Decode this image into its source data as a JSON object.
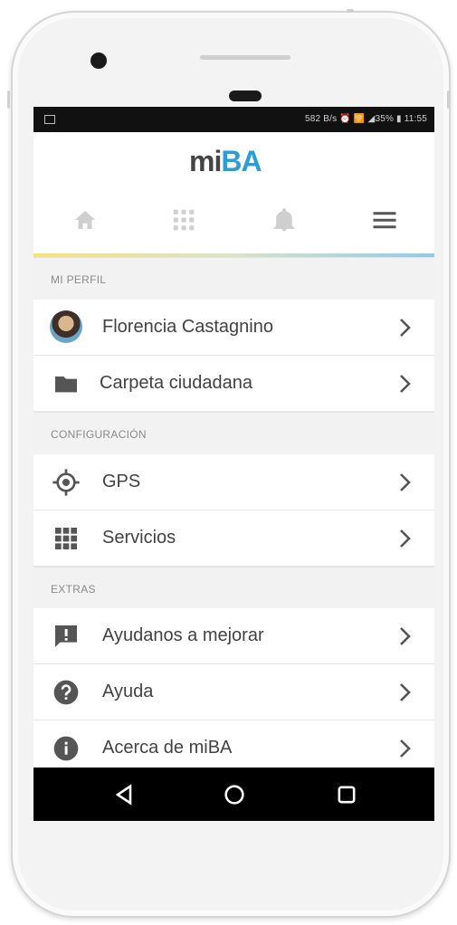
{
  "status_bar": {
    "right_text": "582 B/s ⏰ 🛜 ◢35% ▮ 11:55"
  },
  "app": {
    "logo_mi": "mi",
    "logo_ba": "BA"
  },
  "nav": {
    "items": [
      {
        "icon": "home-icon"
      },
      {
        "icon": "grid-icon"
      },
      {
        "icon": "bell-icon"
      },
      {
        "icon": "menu-icon"
      }
    ]
  },
  "sections": [
    {
      "title": "MI PERFIL",
      "items": [
        {
          "label": "Florencia Castagnino",
          "icon": "avatar"
        },
        {
          "label": "Carpeta ciudadana",
          "icon": "folder-icon"
        }
      ]
    },
    {
      "title": "CONFIGURACIÓN",
      "items": [
        {
          "label": "GPS",
          "icon": "gps-icon"
        },
        {
          "label": "Servicios",
          "icon": "grid-icon"
        }
      ]
    },
    {
      "title": "EXTRAS",
      "items": [
        {
          "label": "Ayudanos a mejorar",
          "icon": "feedback-icon"
        },
        {
          "label": "Ayuda",
          "icon": "help-icon"
        },
        {
          "label": "Acerca de miBA",
          "icon": "info-icon"
        }
      ]
    }
  ],
  "colors": {
    "accent_blue": "#2a9fd6",
    "accent_yellow": "#f3d43c",
    "text": "#424242"
  }
}
